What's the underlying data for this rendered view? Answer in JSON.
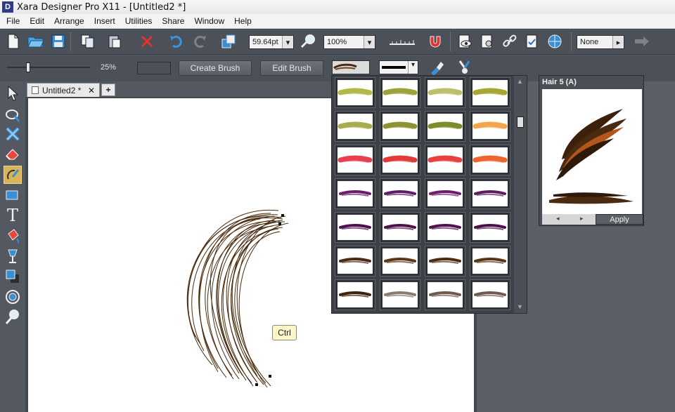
{
  "window": {
    "title": "Xara Designer Pro X11 - [Untitled2 *]",
    "logo_letter": "D"
  },
  "menu": [
    "File",
    "Edit",
    "Arrange",
    "Insert",
    "Utilities",
    "Share",
    "Window",
    "Help"
  ],
  "toolbar": {
    "line_width": "59.64pt",
    "zoom": "100%",
    "fill_value": "None"
  },
  "brush_bar": {
    "scale_percent": "25%",
    "slider_fraction": 0.25,
    "create_label": "Create Brush",
    "edit_label": "Edit Brush"
  },
  "document": {
    "tab_label": "Untitled2 *",
    "new_tab_label": "+"
  },
  "tooltip": {
    "text": "Ctrl"
  },
  "gallery": {
    "rows": [
      [
        "#b5b846",
        "#9fa23a",
        "#bdbf6a",
        "#a6a832"
      ],
      [
        "#a9ac4c",
        "#8f9233",
        "#7f8a2a",
        "#f2a54a"
      ],
      [
        "#e8404f",
        "#e23a3a",
        "#e84040",
        "#f0642d"
      ],
      [
        "#6a1e6a",
        "#5b1b66",
        "#6b1d6b",
        "#5c1d5c"
      ],
      [
        "#4f0f4f",
        "#4c1047",
        "#52104e",
        "#4a0f47"
      ],
      [
        "#4a2a12",
        "#5a3614",
        "#4c2b10",
        "#573415"
      ],
      [
        "#3e2410",
        "#8a7a70",
        "#6d5a4c",
        "#6e5a4f"
      ]
    ]
  },
  "preview": {
    "title": "Hair 5 (A)",
    "apply_label": "Apply"
  },
  "icons": {
    "brush_tool": "brush-icon",
    "selector": "arrow-icon"
  }
}
